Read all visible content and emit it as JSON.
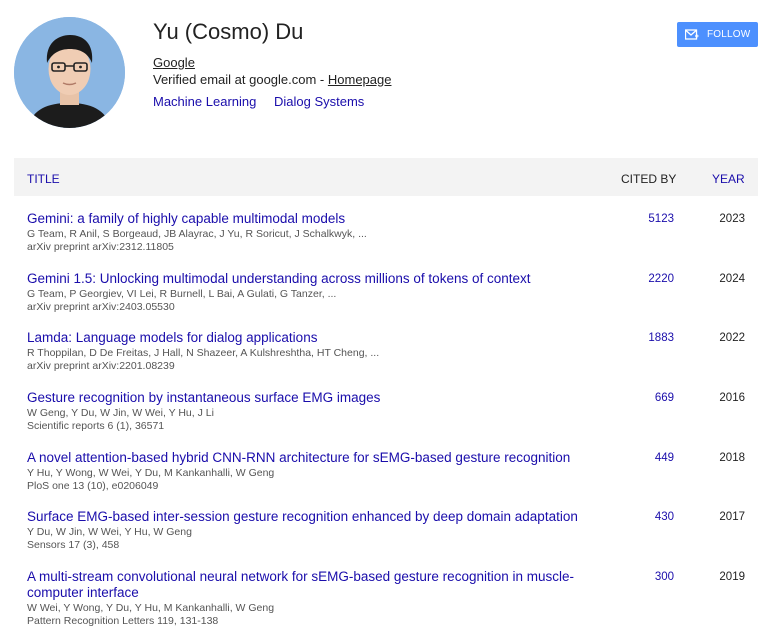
{
  "profile": {
    "name": "Yu (Cosmo) Du",
    "affiliation": "Google",
    "email_text": "Verified email at google.com - ",
    "homepage_label": "Homepage",
    "interests": [
      "Machine Learning",
      "Dialog Systems"
    ],
    "follow_label": "FOLLOW"
  },
  "table": {
    "headers": {
      "title": "TITLE",
      "cited_by": "CITED BY",
      "year": "YEAR"
    },
    "rows": [
      {
        "title": "Gemini: a family of highly capable multimodal models",
        "authors": "G Team, R Anil, S Borgeaud, JB Alayrac, J Yu, R Soricut, J Schalkwyk, ...",
        "venue": "arXiv preprint arXiv:2312.11805",
        "cited_by": "5123",
        "year": "2023"
      },
      {
        "title": "Gemini 1.5: Unlocking multimodal understanding across millions of tokens of context",
        "authors": "G Team, P Georgiev, VI Lei, R Burnell, L Bai, A Gulati, G Tanzer, ...",
        "venue": "arXiv preprint arXiv:2403.05530",
        "cited_by": "2220",
        "year": "2024"
      },
      {
        "title": "Lamda: Language models for dialog applications",
        "authors": "R Thoppilan, D De Freitas, J Hall, N Shazeer, A Kulshreshtha, HT Cheng, ...",
        "venue": "arXiv preprint arXiv:2201.08239",
        "cited_by": "1883",
        "year": "2022"
      },
      {
        "title": "Gesture recognition by instantaneous surface EMG images",
        "authors": "W Geng, Y Du, W Jin, W Wei, Y Hu, J Li",
        "venue": "Scientific reports 6 (1), 36571",
        "cited_by": "669",
        "year": "2016"
      },
      {
        "title": "A novel attention-based hybrid CNN-RNN architecture for sEMG-based gesture recognition",
        "authors": "Y Hu, Y Wong, W Wei, Y Du, M Kankanhalli, W Geng",
        "venue": "PloS one 13 (10), e0206049",
        "cited_by": "449",
        "year": "2018"
      },
      {
        "title": "Surface EMG-based inter-session gesture recognition enhanced by deep domain adaptation",
        "authors": "Y Du, W Jin, W Wei, Y Hu, W Geng",
        "venue": "Sensors 17 (3), 458",
        "cited_by": "430",
        "year": "2017"
      },
      {
        "title": "A multi-stream convolutional neural network for sEMG-based gesture recognition in muscle-computer interface",
        "authors": "W Wei, Y Wong, Y Du, Y Hu, M Kankanhalli, W Geng",
        "venue": "Pattern Recognition Letters 119, 131-138",
        "cited_by": "300",
        "year": "2019"
      }
    ]
  },
  "colors": {
    "link": "#1a0dab",
    "follow_button": "#4d90fe",
    "header_bg": "#f3f3f3",
    "meta_text": "#555555"
  },
  "icons": {
    "follow": "envelope-icon"
  }
}
